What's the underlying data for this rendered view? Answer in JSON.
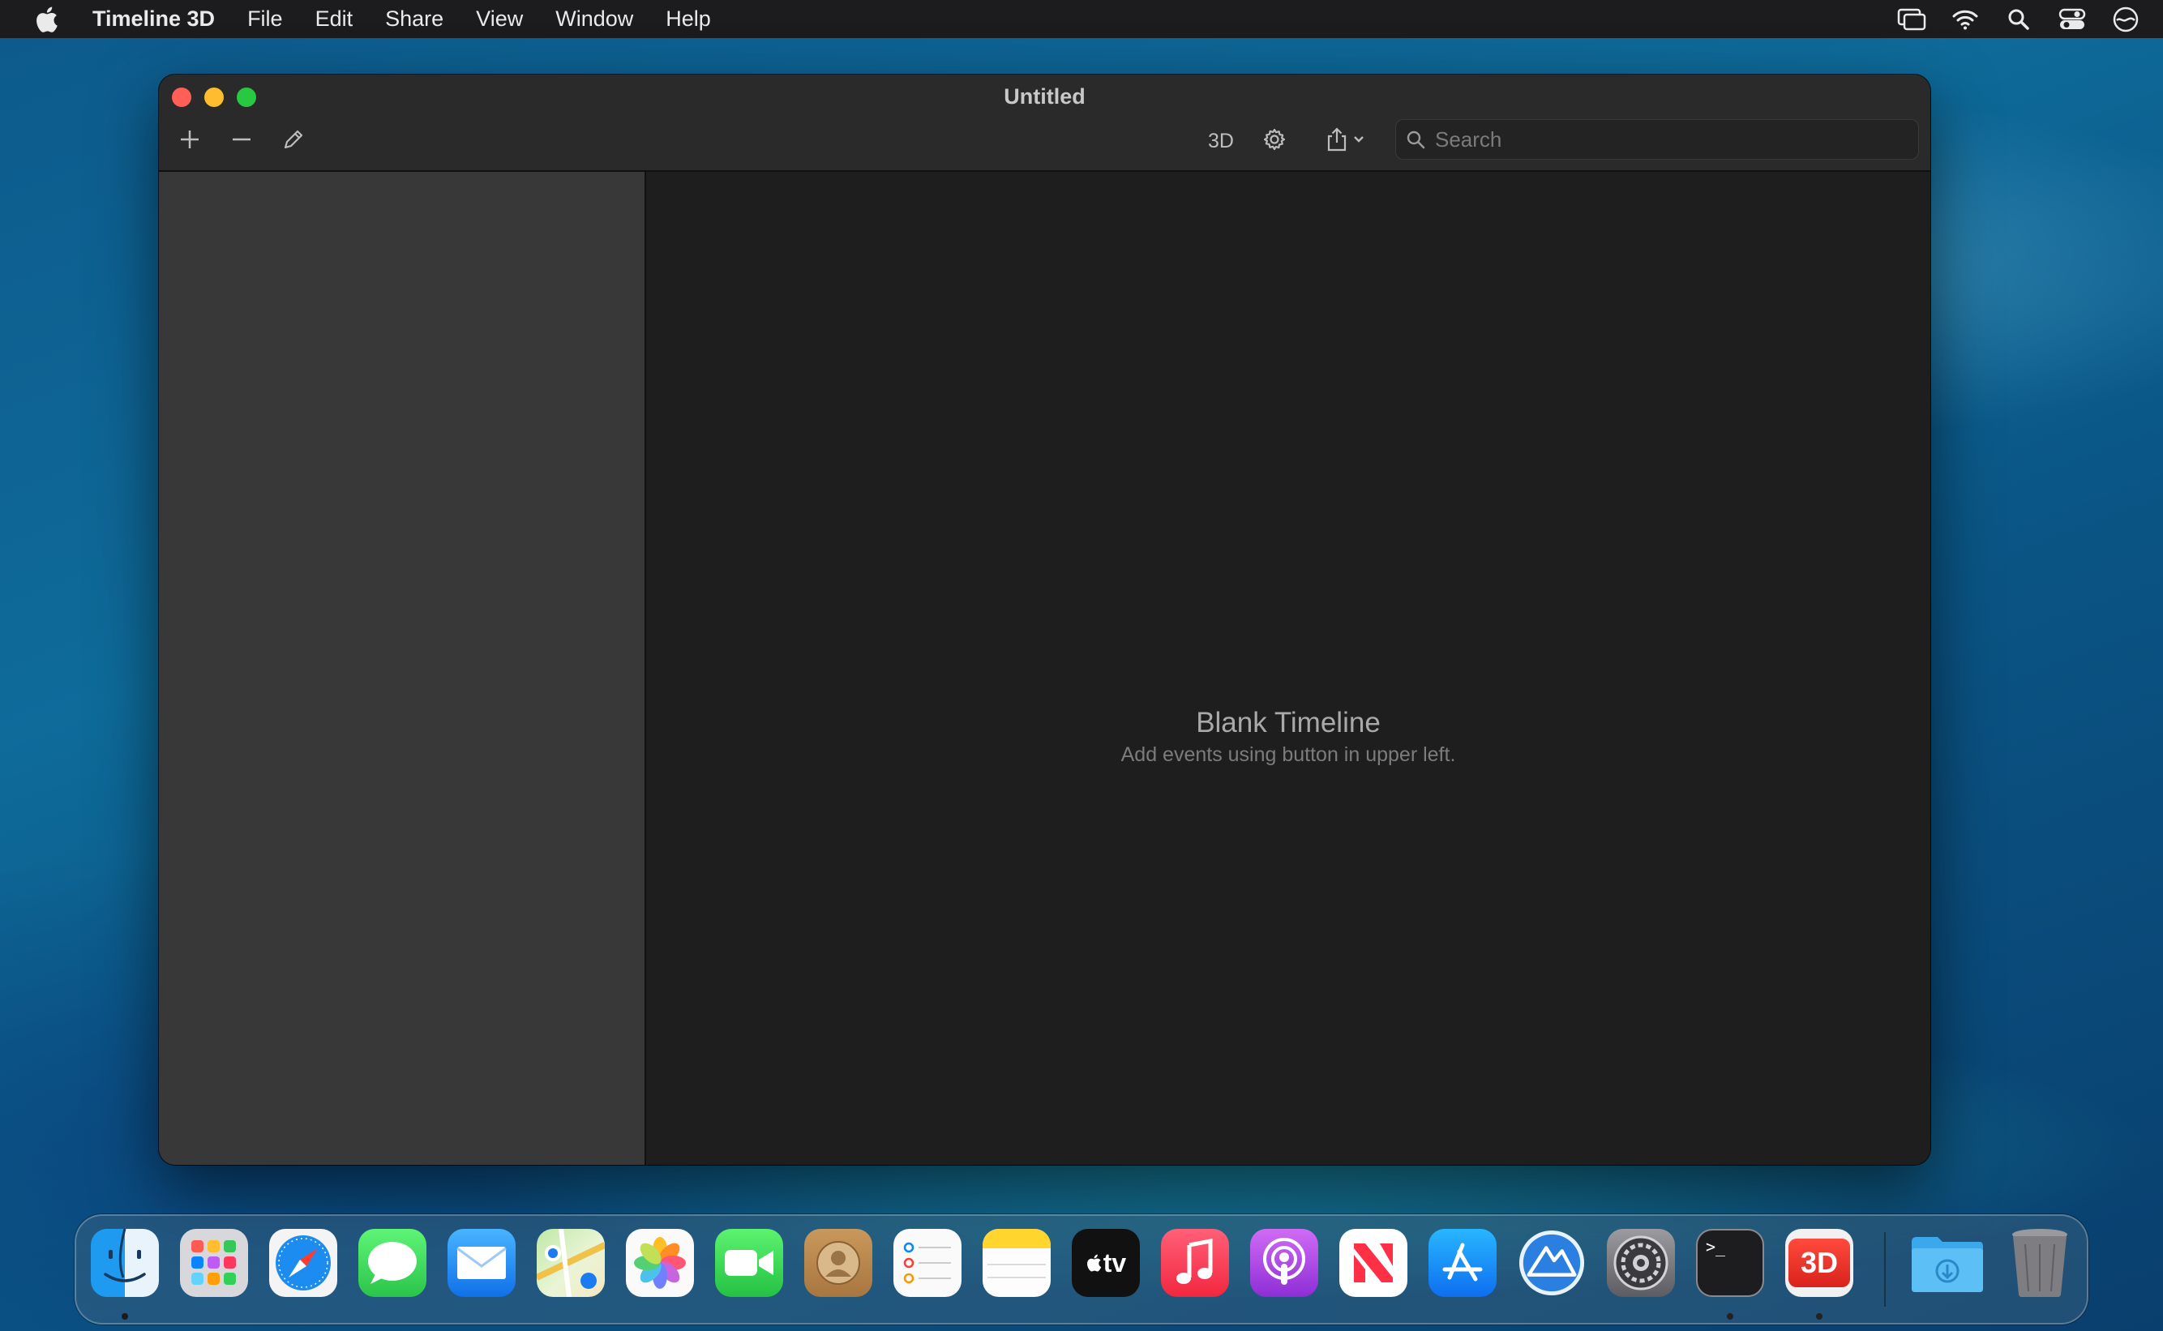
{
  "menubar": {
    "app_name": "Timeline 3D",
    "items": [
      "File",
      "Edit",
      "Share",
      "View",
      "Window",
      "Help"
    ],
    "status_icons": [
      "screen-mirroring-icon",
      "wifi-icon",
      "spotlight-search-icon",
      "control-center-icon",
      "siri-icon"
    ]
  },
  "window": {
    "title": "Untitled",
    "toolbar": {
      "add_icon": "plus-icon",
      "remove_icon": "minus-icon",
      "edit_icon": "pencil-icon",
      "threed_label": "3D",
      "settings_icon": "gear-icon",
      "share_icon": "share-icon",
      "search_placeholder": "Search",
      "search_value": ""
    },
    "main": {
      "empty_title": "Blank Timeline",
      "empty_subtitle": "Add events using button in upper left."
    }
  },
  "dock": {
    "apps": [
      {
        "name": "finder-icon",
        "running": true
      },
      {
        "name": "launchpad-icon",
        "running": false
      },
      {
        "name": "safari-icon",
        "running": false
      },
      {
        "name": "messages-icon",
        "running": false
      },
      {
        "name": "mail-icon",
        "running": false
      },
      {
        "name": "maps-icon",
        "running": false
      },
      {
        "name": "photos-icon",
        "running": false
      },
      {
        "name": "facetime-icon",
        "running": false
      },
      {
        "name": "contacts-icon",
        "running": false
      },
      {
        "name": "reminders-icon",
        "running": false
      },
      {
        "name": "notes-icon",
        "running": false
      },
      {
        "name": "apple-tv-icon",
        "running": false
      },
      {
        "name": "music-icon",
        "running": false
      },
      {
        "name": "podcasts-icon",
        "running": false
      },
      {
        "name": "news-icon",
        "running": false
      },
      {
        "name": "app-store-icon",
        "running": false
      },
      {
        "name": "monterey-installer-icon",
        "running": false
      },
      {
        "name": "system-preferences-icon",
        "running": false
      },
      {
        "name": "terminal-icon",
        "running": true
      },
      {
        "name": "timeline-3d-icon",
        "running": true
      }
    ],
    "tv_label": "tv",
    "timeline_label": "3D",
    "terminal_label": ">_",
    "extras": [
      "downloads-folder-icon",
      "trash-icon"
    ]
  },
  "colors": {
    "close": "#ff5f57",
    "minimize": "#febc2e",
    "maximize": "#28c840",
    "sidebar": "#383838",
    "main": "#1e1e1e"
  }
}
